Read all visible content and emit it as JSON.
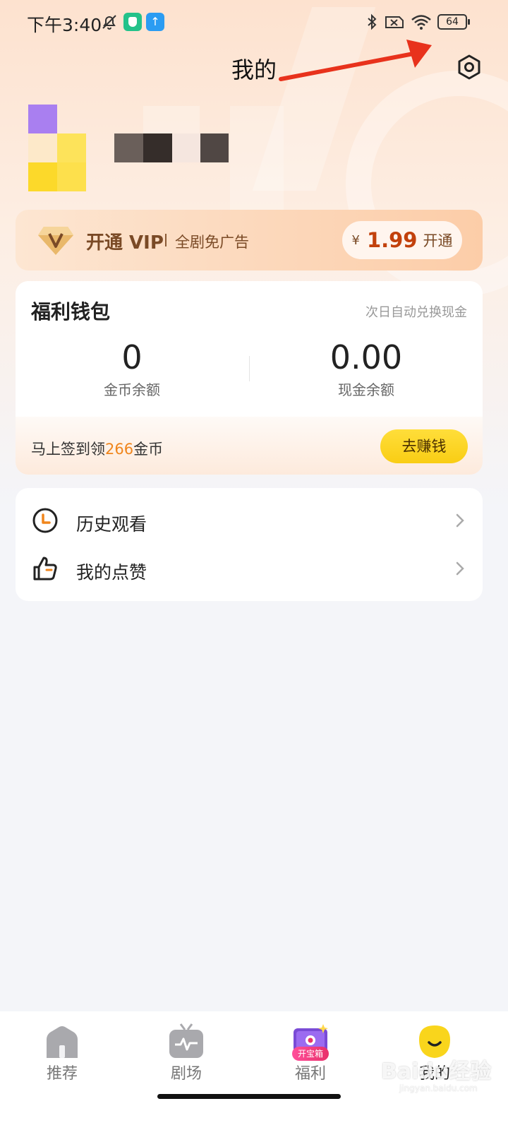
{
  "status_bar": {
    "time": "下午3:40",
    "battery": "64",
    "icons": [
      "bell-off-icon",
      "shield-app-icon",
      "upload-app-icon",
      "bluetooth-icon",
      "sim-x-icon",
      "wifi-icon",
      "battery-icon"
    ]
  },
  "header": {
    "title": "我的",
    "settings_icon": "settings-icon"
  },
  "vip": {
    "title": "开通 VIP",
    "desc": "全剧免广告",
    "currency": "¥",
    "price": "1.99",
    "action": "开通"
  },
  "wallet": {
    "title": "福利钱包",
    "note": "次日自动兑换现金",
    "coins": {
      "value": "0",
      "label": "金币余额"
    },
    "cash": {
      "value": "0.00",
      "label": "现金余额"
    },
    "signin_prefix": "马上签到领",
    "signin_amount": "266",
    "signin_suffix": "金币",
    "earn_button": "去赚钱"
  },
  "menu": {
    "items": [
      {
        "label": "历史观看",
        "icon": "clock-icon"
      },
      {
        "label": "我的点赞",
        "icon": "thumbs-up-icon"
      }
    ]
  },
  "nav": {
    "items": [
      {
        "label": "推荐",
        "icon": "home-icon",
        "active": false
      },
      {
        "label": "剧场",
        "icon": "tv-icon",
        "active": false
      },
      {
        "label": "福利",
        "icon": "treasure-box-icon",
        "badge": "开宝箱",
        "active": false
      },
      {
        "label": "我的",
        "icon": "smiley-icon",
        "active": true
      }
    ]
  },
  "watermark": {
    "text": "Baidu经验",
    "sub": "jingyan.baidu.com"
  },
  "colors": {
    "accent_yellow": "#f9cd14",
    "vip_price": "#c2410c",
    "highlight_orange": "#f0851c",
    "vip_text": "#7a4a26",
    "annotation_arrow": "#e8321c"
  }
}
